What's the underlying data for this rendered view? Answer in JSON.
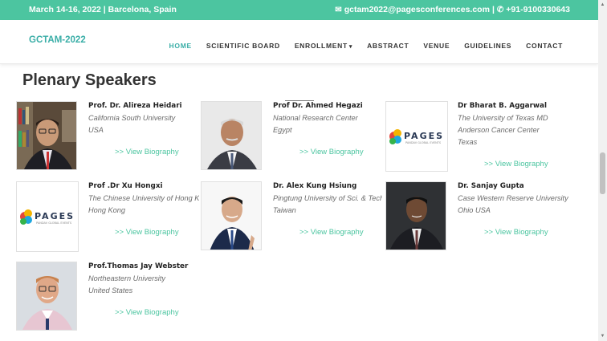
{
  "topbar": {
    "dates": "March 14-16, 2022 | Barcelona, Spain",
    "email": "gctam2022@pagesconferences.com",
    "separator": "|",
    "phone": "+91-9100330643"
  },
  "brand": "GCTAM-2022",
  "nav": [
    "HOME",
    "SCIENTIFIC BOARD",
    "ENROLLMENT",
    "ABSTRACT",
    "VENUE",
    "GUIDELINES",
    "CONTACT"
  ],
  "heading": "Plenary Speakers",
  "bio_link_label": ">> View Biography",
  "speakers": [
    {
      "name": "Prof. Dr. Alireza Heidari",
      "lines": [
        "California South University",
        "USA"
      ]
    },
    {
      "name": "Prof Dr. Ahmed Hegazi",
      "lines": [
        "National Research Center",
        "Egypt"
      ]
    },
    {
      "name": "Dr Bharat B. Aggarwal",
      "lines": [
        "The University of Texas MD",
        "Anderson Cancer Center",
        "Texas"
      ]
    },
    {
      "name": "Prof .Dr Xu Hongxi",
      "lines": [
        "The Chinese University of Hong Kong",
        "Hong Kong"
      ]
    },
    {
      "name": "Dr. Alex Kung Hsiung",
      "lines": [
        "Pingtung University of Sci. & Tech",
        "Taiwan"
      ]
    },
    {
      "name": "Dr. Sanjay Gupta",
      "lines": [
        "Case Western Reserve University",
        "Ohio USA"
      ]
    },
    {
      "name": "Prof.Thomas Jay Webster",
      "lines": [
        "Northeastern University",
        "United States"
      ]
    }
  ],
  "placeholder_logo": {
    "title": "PAGES",
    "subtitle": "PANDAV GLOBAL EVENTS"
  }
}
